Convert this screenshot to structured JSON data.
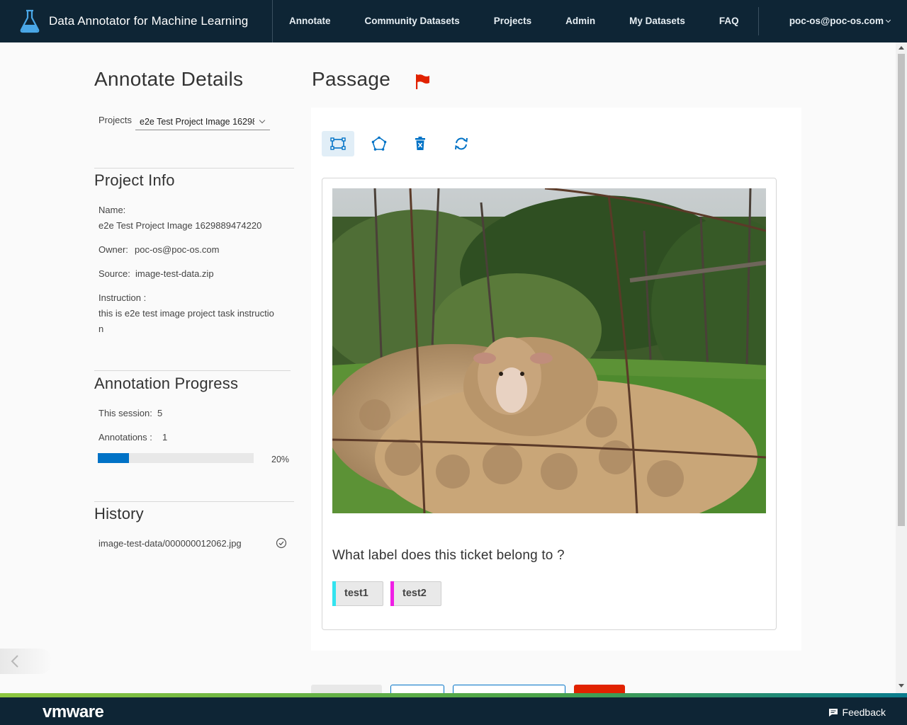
{
  "header": {
    "app_title": "Data Annotator for Machine Learning",
    "nav": [
      "Annotate",
      "Community Datasets",
      "Projects",
      "Admin",
      "My Datasets",
      "FAQ"
    ],
    "user": "poc-os@poc-os.com"
  },
  "sidebar": {
    "title": "Annotate Details",
    "projects_label": "Projects",
    "projects_value": "e2e Test Project Image 1629889474220",
    "project_info": {
      "heading": "Project Info",
      "name_label": "Name:",
      "name_value": "e2e Test Project Image 1629889474220",
      "owner_label": "Owner:",
      "owner_value": "poc-os@poc-os.com",
      "source_label": "Source:",
      "source_value": "image-test-data.zip",
      "instruction_label": "Instruction :",
      "instruction_line1": "this is e2e test image project task instructio",
      "instruction_line2": "n"
    },
    "progress": {
      "heading": "Annotation Progress",
      "session_label": "This session:",
      "session_value": "5",
      "annotations_label": "Annotations :",
      "annotations_value": "1",
      "percent": 20,
      "percent_label": "20%"
    },
    "history": {
      "heading": "History",
      "items": [
        "image-test-data/000000012062.jpg"
      ]
    }
  },
  "main": {
    "title": "Passage",
    "tools": [
      "bounding-box-tool",
      "polygon-tool",
      "delete-tool",
      "reset-tool"
    ],
    "question": "What label does this ticket belong to ?",
    "labels": [
      {
        "text": "test1",
        "color": "#33e3ef"
      },
      {
        "text": "test2",
        "color": "#ef1fe5"
      }
    ]
  },
  "footer": {
    "brand": "vmware",
    "feedback": "Feedback"
  },
  "colors": {
    "header_bg": "#0e2535",
    "accent": "#0072c6",
    "flag": "#e12200"
  }
}
